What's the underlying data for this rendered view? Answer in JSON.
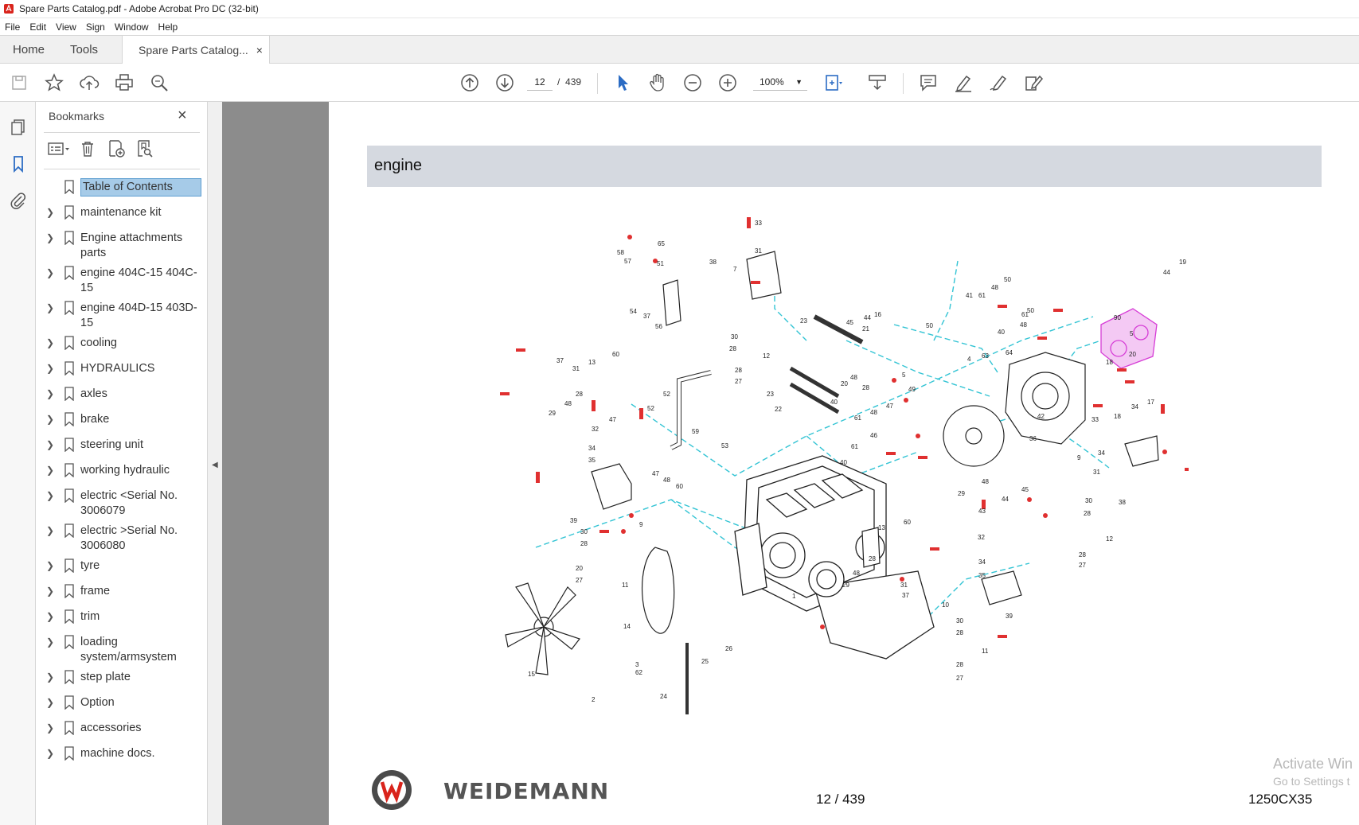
{
  "window": {
    "title": "Spare Parts Catalog.pdf - Adobe Acrobat Pro DC (32-bit)"
  },
  "menu": [
    "File",
    "Edit",
    "View",
    "Sign",
    "Window",
    "Help"
  ],
  "tabs": {
    "home": "Home",
    "tools": "Tools",
    "document": "Spare Parts Catalog...",
    "close": "×"
  },
  "toolbar": {
    "page_current": "12",
    "page_separator": "/",
    "page_total": "439",
    "zoom": "100%"
  },
  "bookmarks": {
    "title": "Bookmarks",
    "close": "×",
    "items": [
      {
        "label": "Table of Contents",
        "expandable": false,
        "selected": true
      },
      {
        "label": "maintenance kit",
        "expandable": true
      },
      {
        "label": "Engine attachments parts",
        "expandable": true
      },
      {
        "label": "engine 404C-15 404C-15",
        "expandable": true
      },
      {
        "label": "engine 404D-15 403D-15",
        "expandable": true
      },
      {
        "label": "cooling",
        "expandable": true
      },
      {
        "label": "HYDRAULICS",
        "expandable": true
      },
      {
        "label": "axles",
        "expandable": true
      },
      {
        "label": "brake",
        "expandable": true
      },
      {
        "label": "steering unit",
        "expandable": true
      },
      {
        "label": "working hydraulic",
        "expandable": true
      },
      {
        "label": "electric <Serial No. 3006079",
        "expandable": true
      },
      {
        "label": "electric >Serial No. 3006080",
        "expandable": true
      },
      {
        "label": "tyre",
        "expandable": true
      },
      {
        "label": "frame",
        "expandable": true
      },
      {
        "label": "trim",
        "expandable": true
      },
      {
        "label": "loading system/armsystem",
        "expandable": true
      },
      {
        "label": "step plate",
        "expandable": true
      },
      {
        "label": "Option",
        "expandable": true
      },
      {
        "label": "accessories",
        "expandable": true
      },
      {
        "label": "machine docs.",
        "expandable": true
      }
    ]
  },
  "document": {
    "section_title": "engine",
    "brand": "WEIDEMANN",
    "footer_page": "12 / 439",
    "footer_code": "1250CX35"
  },
  "watermark": {
    "line1": "Activate Win",
    "line2": "Go to Settings t"
  },
  "colors": {
    "accent_blue": "#2b6cc4",
    "header_band": "#d5d9e0",
    "selected_bookmark": "#a6cbe8",
    "part_red": "#e03030",
    "leader_cyan": "#33c4d4",
    "pump_magenta": "#d63cd6"
  }
}
